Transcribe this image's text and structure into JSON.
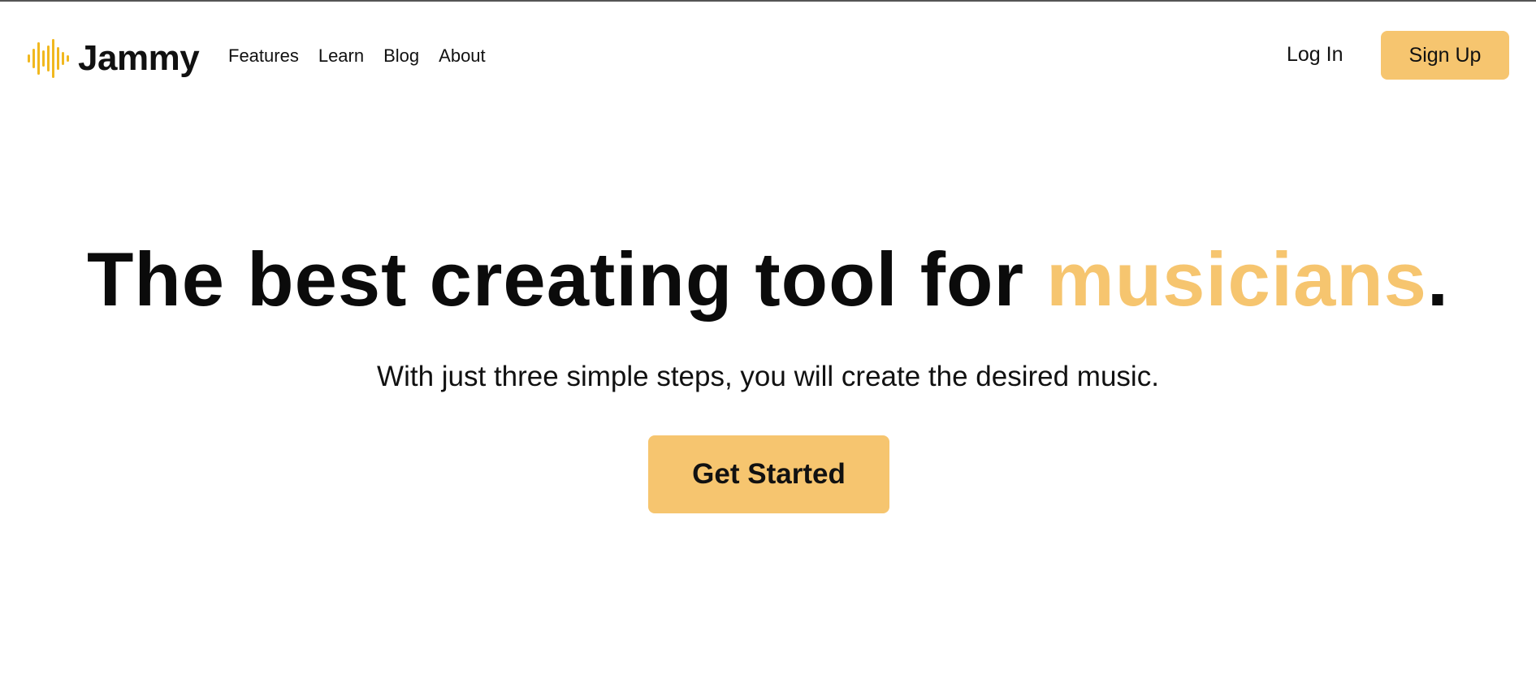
{
  "colors": {
    "accent": "#f6c56f",
    "logo": "#f1b81f",
    "text": "#111111",
    "background": "#ffffff"
  },
  "nav": {
    "brand": {
      "name": "Jammy",
      "icon": "sound-wave-icon"
    },
    "links": [
      "Features",
      "Learn",
      "Blog",
      "About"
    ],
    "login_label": "Log In",
    "signup_label": "Sign Up"
  },
  "hero": {
    "title_prefix": "The best creating tool for ",
    "title_accent": "musicians",
    "title_suffix": ".",
    "subtitle": "With just three simple steps, you will create the desired music.",
    "cta_label": "Get Started"
  }
}
